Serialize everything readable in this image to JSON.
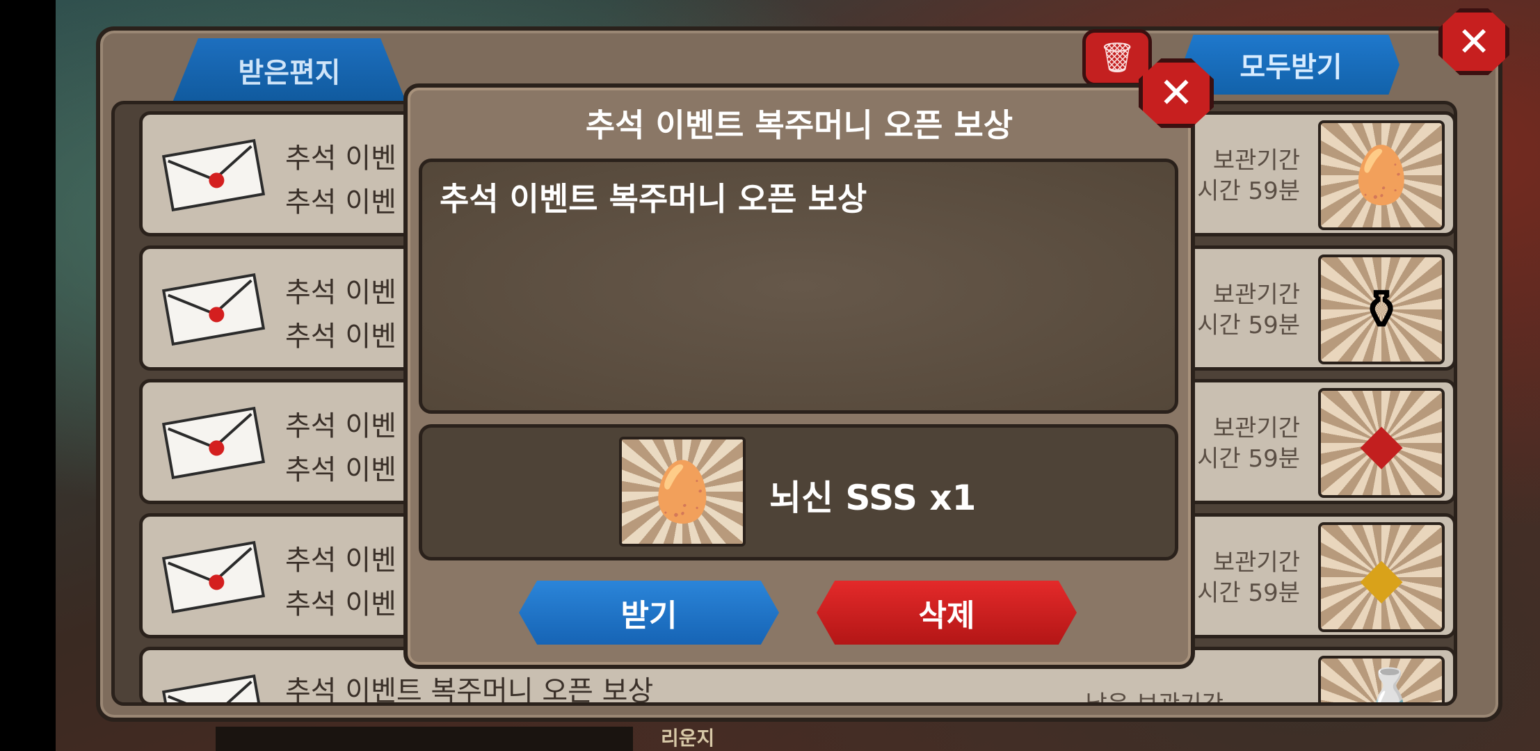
{
  "mailbox": {
    "tab_received": "받은편지",
    "receive_all": "모두받기",
    "trash_icon": "trash-icon",
    "close_icon": "close-icon",
    "rows": [
      {
        "title": "추석 이벤",
        "subtitle": "추석 이벤",
        "expire_label": "보관기간",
        "expire_time": "시간 59분",
        "item_icon": "egg-cloud-icon"
      },
      {
        "title": "추석 이벤",
        "subtitle": "추석 이벤",
        "expire_label": "보관기간",
        "expire_time": "시간 59분",
        "item_icon": "potion-vase-icon"
      },
      {
        "title": "추석 이벤",
        "subtitle": "추석 이벤",
        "expire_label": "보관기간",
        "expire_time": "시간 59분",
        "item_icon": "red-emblem-icon"
      },
      {
        "title": "추석 이벤",
        "subtitle": "추석 이벤",
        "expire_label": "보관기간",
        "expire_time": "시간 59분",
        "item_icon": "gold-emblem-icon"
      },
      {
        "title": "추석 이벤트 복주머니 오픈 보상",
        "subtitle": "",
        "expire_label": "남은 보관기간",
        "expire_time": "",
        "item_icon": "bottle-icon"
      }
    ],
    "bottom_label": "리운지"
  },
  "modal": {
    "title": "추석 이벤트 복주머니 오픈 보상",
    "message": "추석 이벤트 복주머니 오픈 보상",
    "reward_text": "뇌신 SSS x1",
    "reward_icon": "egg-cloud-icon",
    "accept_label": "받기",
    "delete_label": "삭제"
  },
  "colors": {
    "accept": "#1664b5",
    "delete": "#c71f1f",
    "panel": "#7e6c5c"
  }
}
